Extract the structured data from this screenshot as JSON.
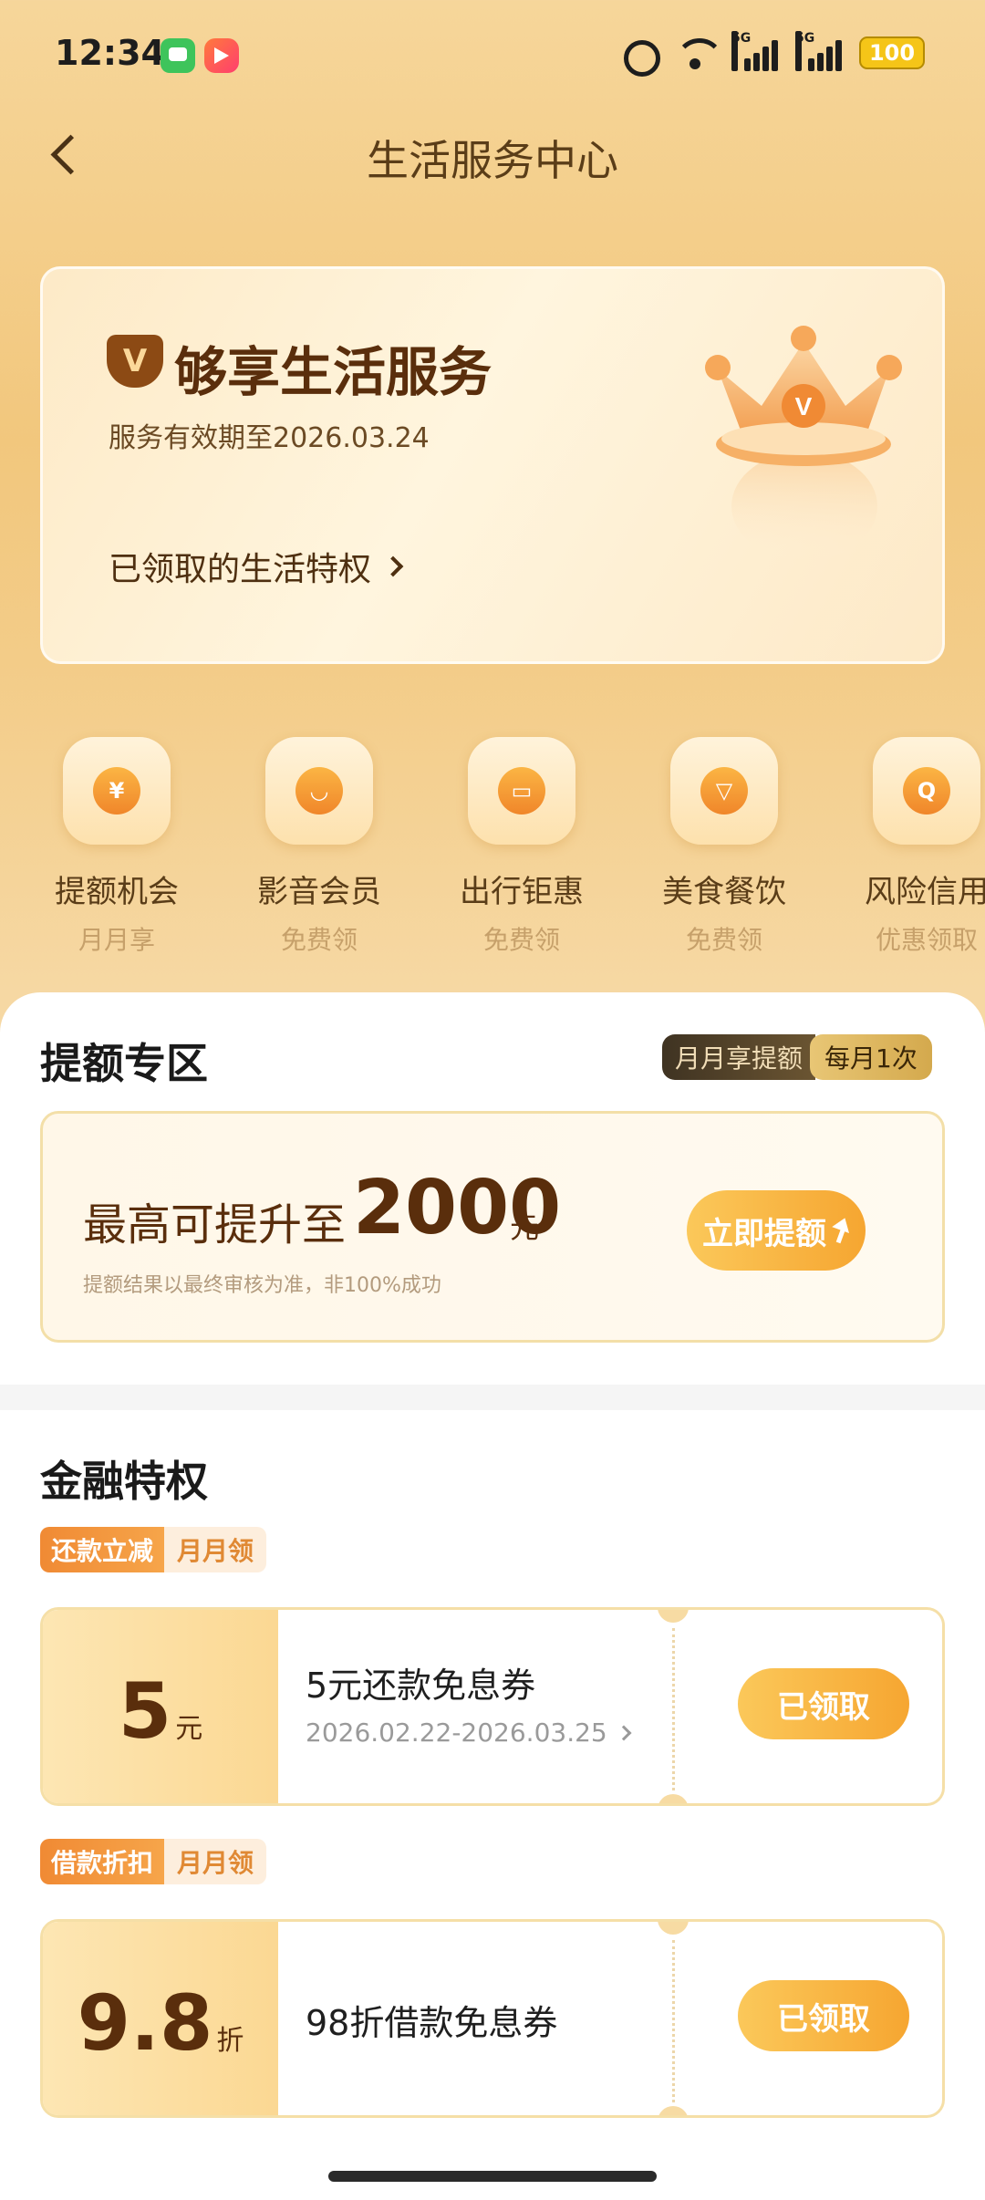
{
  "status_bar": {
    "time": "12:34",
    "network1": "5G",
    "network2": "5G",
    "battery": "100"
  },
  "header": {
    "title": "生活服务中心"
  },
  "hero": {
    "badge": "V",
    "title": "够享生活服务",
    "validity": "服务有效期至2026.03.24",
    "link": "已领取的生活特权",
    "crown_badge": "V"
  },
  "categories": [
    {
      "label": "提额机会",
      "sub": "月月享",
      "glyph": "¥"
    },
    {
      "label": "影音会员",
      "sub": "免费领",
      "glyph": "◡"
    },
    {
      "label": "出行钜惠",
      "sub": "免费领",
      "glyph": "▭"
    },
    {
      "label": "美食餐饮",
      "sub": "免费领",
      "glyph": "▽"
    },
    {
      "label": "风险信用",
      "sub": "优惠领取",
      "glyph": "Q"
    }
  ],
  "limit_section": {
    "title": "提额专区",
    "tag_left": "月月享提额",
    "tag_right": "每月1次",
    "prefix": "最高可提升至",
    "amount": "2000",
    "unit": "元",
    "note": "提额结果以最终审核为准，非100%成功",
    "button": "立即提额"
  },
  "finance_section": {
    "title": "金融特权",
    "coupons": [
      {
        "tag_left": "还款立减",
        "tag_right": "月月领",
        "value": "5",
        "unit": "元",
        "title": "5元还款免息券",
        "date": "2026.02.22-2026.03.25",
        "button": "已领取"
      },
      {
        "tag_left": "借款折扣",
        "tag_right": "月月领",
        "value": "9.8",
        "unit": "折",
        "title": "98折借款免息券",
        "button": "已领取"
      }
    ]
  },
  "colors": {
    "accent": "#f6a631",
    "brown": "#5a2e0c",
    "page_bg": "#f2c77d"
  }
}
